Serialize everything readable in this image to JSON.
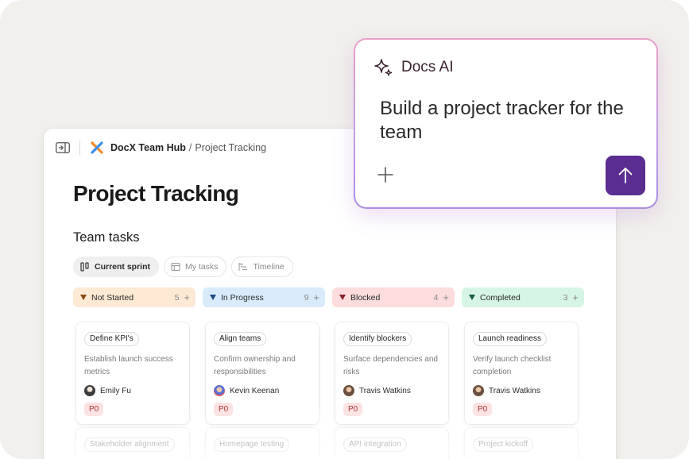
{
  "breadcrumb": {
    "workspace": "DocX Team Hub",
    "separator": "/",
    "page": "Project Tracking"
  },
  "page": {
    "title": "Project Tracking",
    "section_title": "Team tasks"
  },
  "view_tabs": [
    {
      "label": "Current sprint",
      "icon": "board-columns-icon",
      "active": true
    },
    {
      "label": "My tasks",
      "icon": "table-icon",
      "active": false
    },
    {
      "label": "Timeline",
      "icon": "timeline-icon",
      "active": false
    }
  ],
  "columns": [
    {
      "name": "Not Started",
      "count": "5",
      "add": "+",
      "bg": "#fde9d4",
      "caret": "#8a4a14",
      "cards": [
        {
          "title": "Define KPI's",
          "desc": "Establish launch success metrics",
          "assignee": "Emily Fu",
          "priority": "P0",
          "avatar": "#c9b8a8"
        },
        {
          "title": "Stakeholder alignment"
        }
      ]
    },
    {
      "name": "In Progress",
      "count": "9",
      "add": "+",
      "bg": "#d9ebfb",
      "caret": "#1c4a80",
      "cards": [
        {
          "title": "Align teams",
          "desc": "Confirm ownership and responsibilities",
          "assignee": "Kevin Keenan",
          "priority": "P0",
          "avatar": "#6f7fd8"
        },
        {
          "title": "Homepage testing"
        }
      ]
    },
    {
      "name": "Blocked",
      "count": "4",
      "add": "+",
      "bg": "#fcdcdc",
      "caret": "#8a1f2a",
      "cards": [
        {
          "title": "Identify blockers",
          "desc": "Surface dependencies and risks",
          "assignee": "Travis Watkins",
          "priority": "P0",
          "avatar": "#8a6b58"
        },
        {
          "title": "API integration"
        }
      ]
    },
    {
      "name": "Completed",
      "count": "3",
      "add": "+",
      "bg": "#d7f5e4",
      "caret": "#14603a",
      "cards": [
        {
          "title": "Launch readiness",
          "desc": "Verify launch checklist completion",
          "assignee": "Travis Watkins",
          "priority": "P0",
          "avatar": "#8a6b58"
        },
        {
          "title": "Project kickoff"
        }
      ]
    }
  ],
  "ai_panel": {
    "title": "Docs AI",
    "prompt": "Build a project tracker for the team",
    "attach_icon": "plus-icon",
    "send_icon": "arrow-up-icon"
  },
  "colors": {
    "accent": "#5a2d91",
    "priority_bg": "#fde1e1",
    "priority_text": "#a83232"
  }
}
